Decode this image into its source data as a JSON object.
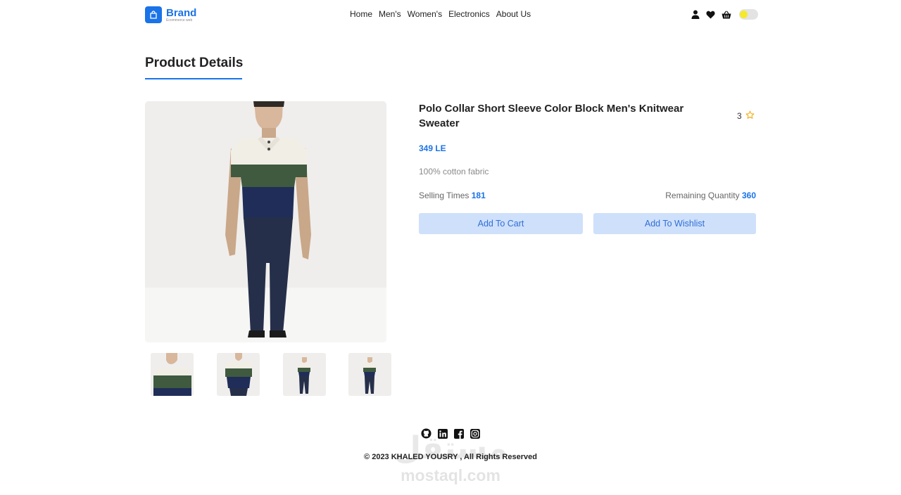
{
  "brand": {
    "name": "Brand",
    "tagline": "Ecommerce web"
  },
  "nav": {
    "links": [
      "Home",
      "Men's",
      "Women's",
      "Electronics",
      "About Us"
    ]
  },
  "colors": {
    "accent": "#1a73e8",
    "button_bg": "#cfe0fb",
    "toggle_knob": "#f4ea2a",
    "star": "#f2b01e"
  },
  "icons": [
    "user-icon",
    "heart-icon",
    "basket-icon",
    "theme-toggle",
    "star-icon",
    "github-icon",
    "linkedin-icon",
    "facebook-icon",
    "instagram-icon"
  ],
  "section": {
    "title": "Product Details"
  },
  "product": {
    "title": "Polo Collar Short Sleeve Color Block Men's Knitwear Sweater",
    "rating": "3",
    "price": "349 LE",
    "description": "100% cotton fabric",
    "selling_label": "Selling Times",
    "selling_value": "181",
    "remaining_label": "Remaining Quantity",
    "remaining_value": "360",
    "add_to_cart": "Add To Cart",
    "add_to_wishlist": "Add To Wishlist"
  },
  "footer": {
    "copyright": "© 2023 KHALED YOUSRY , All Rights Reserved"
  },
  "watermark": {
    "logo": "مستقل",
    "text": "mostaql.com"
  }
}
